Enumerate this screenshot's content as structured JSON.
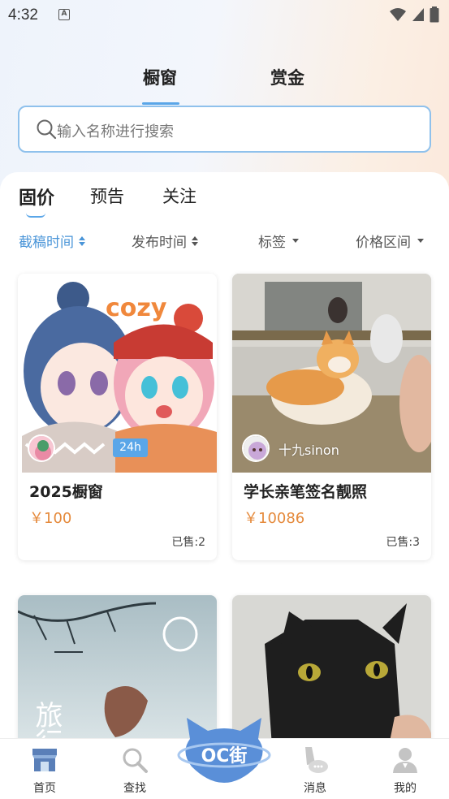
{
  "status_bar": {
    "time": "4:32",
    "notification_letter": "A"
  },
  "top_tabs": [
    {
      "label": "橱窗",
      "active": true
    },
    {
      "label": "赏金",
      "active": false
    }
  ],
  "search": {
    "placeholder": "输入名称进行搜索"
  },
  "sub_tabs": [
    {
      "label": "固价",
      "active": true
    },
    {
      "label": "预告",
      "active": false
    },
    {
      "label": "关注",
      "active": false
    }
  ],
  "filters": [
    {
      "label": "截稿时间",
      "icon": "sort-icon",
      "active": true
    },
    {
      "label": "发布时间",
      "icon": "sort-icon",
      "active": false
    },
    {
      "label": "标签",
      "icon": "dropdown-icon",
      "active": false
    },
    {
      "label": "价格区间",
      "icon": "dropdown-icon",
      "active": false
    }
  ],
  "cards": [
    {
      "title": "2025橱窗",
      "price": "￥100",
      "sold": "已售:2",
      "badge": "24h",
      "user": "",
      "image_text": "cozy"
    },
    {
      "title": "学长亲笔签名靓照",
      "price": "￥10086",
      "sold": "已售:3",
      "badge": "",
      "user": "十九sinon"
    },
    {
      "title": "",
      "price": "",
      "sold": "",
      "image_text": "旅行"
    },
    {
      "title": "",
      "price": "",
      "sold": ""
    }
  ],
  "bottom_nav": [
    {
      "label": "首页",
      "icon": "shop-icon"
    },
    {
      "label": "查找",
      "icon": "search-icon"
    },
    {
      "label": "",
      "icon": "oc-street-logo",
      "logo_text": "OC街"
    },
    {
      "label": "消息",
      "icon": "message-icon"
    },
    {
      "label": "我的",
      "icon": "profile-icon"
    }
  ],
  "colors": {
    "accent": "#5aa6e8",
    "price": "#e58a3c"
  }
}
